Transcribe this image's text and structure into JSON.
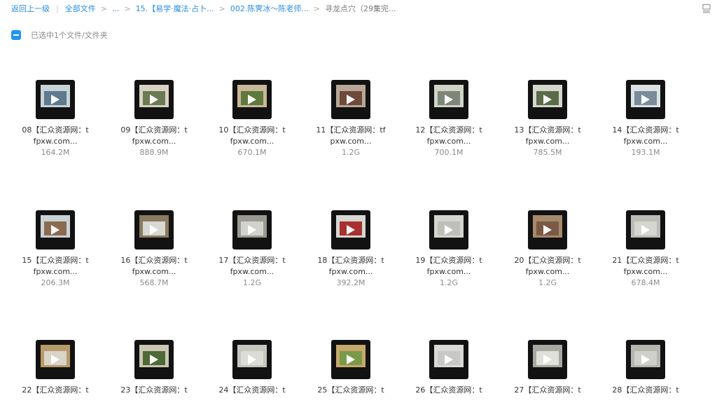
{
  "breadcrumb": {
    "back": "返回上一级",
    "all_files": "全部文件",
    "ellipsis": "...",
    "level1": "15.【易学·魔法·占卜...",
    "level2": "002.陈霁冰～陈老师...",
    "current": "寻龙点穴（29集完..."
  },
  "selection": {
    "text": "已选中1个文件/文件夹"
  },
  "icons": {
    "view_toggle": "list-view-icon",
    "checkbox": "partial-check-icon",
    "play": "play-icon"
  },
  "colors": {
    "link": "#2b8ede",
    "accent": "#1f95f5",
    "thumb_bg": "#121212"
  },
  "files": [
    {
      "line1": "08【汇众资源网：t",
      "line2": "fpxw.com...",
      "size": "164.2M"
    },
    {
      "line1": "09【汇众资源网：t",
      "line2": "fpxw.com...",
      "size": "888.9M"
    },
    {
      "line1": "10【汇众资源网：t",
      "line2": "fpxw.com...",
      "size": "670.1M"
    },
    {
      "line1": "11【汇众资源网：tf",
      "line2": "pxw.com...",
      "size": "1.2G"
    },
    {
      "line1": "12【汇众资源网：t",
      "line2": "fpxw.com...",
      "size": "700.1M"
    },
    {
      "line1": "13【汇众资源网：t",
      "line2": "fpxw.com...",
      "size": "785.5M"
    },
    {
      "line1": "14【汇众资源网：t",
      "line2": "fpxw.com...",
      "size": "193.1M"
    },
    {
      "line1": "15【汇众资源网：t",
      "line2": "fpxw.com...",
      "size": "206.3M"
    },
    {
      "line1": "16【汇众资源网：t",
      "line2": "fpxw.com...",
      "size": "568.7M"
    },
    {
      "line1": "17【汇众资源网：t",
      "line2": "fpxw.com...",
      "size": "1.2G"
    },
    {
      "line1": "18【汇众资源网：t",
      "line2": "fpxw.com...",
      "size": "392.2M"
    },
    {
      "line1": "19【汇众资源网：t",
      "line2": "fpxw.com...",
      "size": "1.2G"
    },
    {
      "line1": "20【汇众资源网：t",
      "line2": "fpxw.com...",
      "size": "1.2G"
    },
    {
      "line1": "21【汇众资源网：t",
      "line2": "fpxw.com...",
      "size": "678.4M"
    },
    {
      "line1": "22【汇众资源网：t",
      "line2": "",
      "size": ""
    },
    {
      "line1": "23【汇众资源网：t",
      "line2": "",
      "size": ""
    },
    {
      "line1": "24【汇众资源网：t",
      "line2": "",
      "size": ""
    },
    {
      "line1": "25【汇众资源网：t",
      "line2": "",
      "size": ""
    },
    {
      "line1": "26【汇众资源网：t",
      "line2": "",
      "size": ""
    },
    {
      "line1": "27【汇众资源网：t",
      "line2": "",
      "size": ""
    },
    {
      "line1": "28【汇众资源网：t",
      "line2": "",
      "size": ""
    }
  ]
}
